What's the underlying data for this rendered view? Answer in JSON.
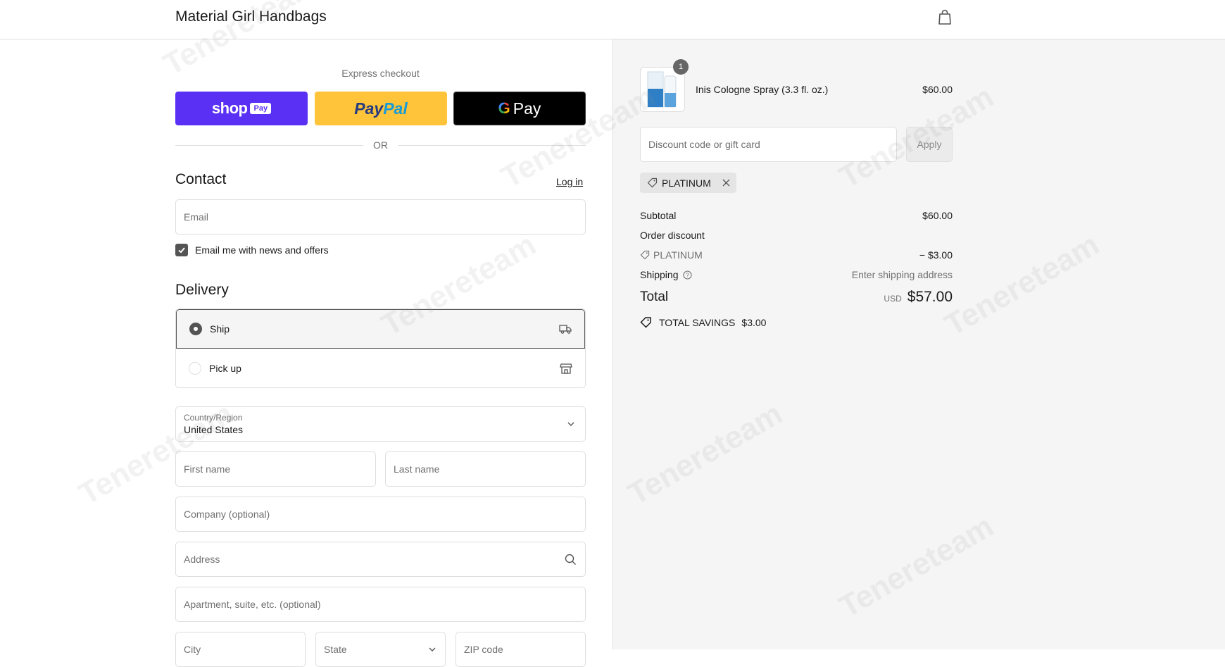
{
  "header": {
    "store_name": "Material Girl Handbags",
    "cart_icon": "shopping-bag-icon"
  },
  "express": {
    "title": "Express checkout",
    "shop_pay": {
      "brand": "shop",
      "badge": "Pay"
    },
    "paypal": {
      "part1": "Pay",
      "part2": "Pal"
    },
    "gpay": {
      "g": "G",
      "label": "Pay"
    },
    "or_label": "OR"
  },
  "contact": {
    "title": "Contact",
    "login_link": "Log in",
    "email_placeholder": "Email",
    "newsletter_label": "Email me with news and offers",
    "newsletter_checked": true
  },
  "delivery": {
    "title": "Delivery",
    "options": [
      {
        "label": "Ship",
        "selected": true,
        "icon": "truck-icon"
      },
      {
        "label": "Pick up",
        "selected": false,
        "icon": "store-icon"
      }
    ],
    "country_label": "Country/Region",
    "country_value": "United States",
    "first_name_placeholder": "First name",
    "last_name_placeholder": "Last name",
    "company_placeholder": "Company (optional)",
    "address_placeholder": "Address",
    "apartment_placeholder": "Apartment, suite, etc. (optional)",
    "city_placeholder": "City",
    "state_placeholder": "State",
    "zip_placeholder": "ZIP code"
  },
  "summary": {
    "item": {
      "quantity": "1",
      "name": "Inis Cologne Spray (3.3 fl. oz.)",
      "price": "$60.00"
    },
    "discount_placeholder": "Discount code or gift card",
    "apply_label": "Apply",
    "applied_code": "PLATINUM",
    "subtotal_label": "Subtotal",
    "subtotal_value": "$60.00",
    "order_discount_label": "Order discount",
    "discount_code_label": "PLATINUM",
    "discount_value": "− $3.00",
    "shipping_label": "Shipping",
    "shipping_value": "Enter shipping address",
    "total_label": "Total",
    "currency": "USD",
    "total_value": "$57.00",
    "savings_label": "TOTAL SAVINGS",
    "savings_value": "$3.00"
  },
  "colors": {
    "shop_pay": "#5a31f4",
    "paypal": "#ffc439",
    "gpay": "#000000",
    "sidebar_bg": "#f5f5f5"
  },
  "watermark": "Tenereteam"
}
